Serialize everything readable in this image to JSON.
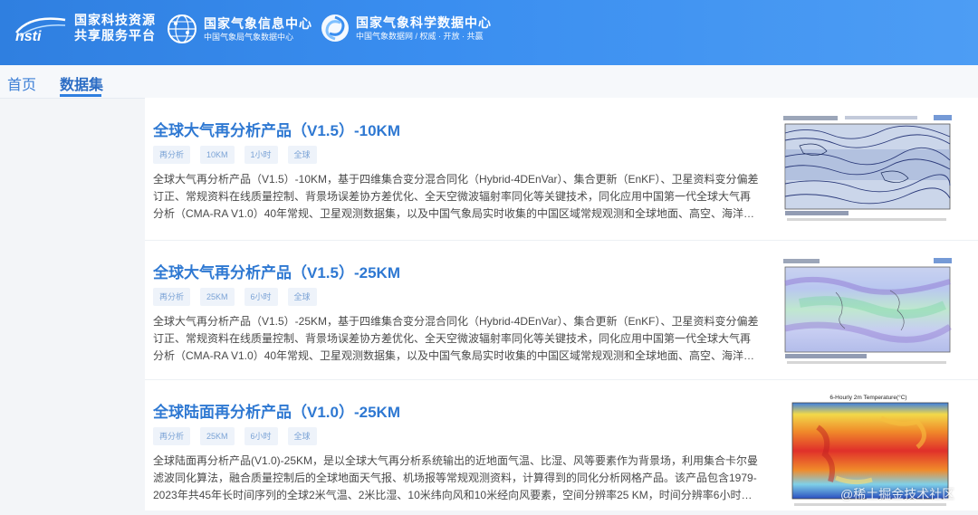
{
  "header": {
    "brands": [
      {
        "line1": "国家科技资源",
        "line2": "共享服务平台",
        "logo_icon": "nsti-logo-icon"
      },
      {
        "line1": "国家气象信息中心",
        "line2": "中国气象局气象数据中心",
        "logo_icon": "globe-network-icon"
      },
      {
        "line1": "国家气象科学数据中心",
        "line2": "中国气象数据网 / 权威 · 开放 · 共赢",
        "logo_icon": "swirl-logo-icon"
      }
    ],
    "bg_color": "#3a8ef0"
  },
  "nav": {
    "items": [
      {
        "label": "首页"
      },
      {
        "label": "数据集"
      }
    ],
    "active_index": 1
  },
  "datasets": [
    {
      "title": "全球大气再分析产品（V1.5）-10KM",
      "tags": [
        "再分析",
        "10KM",
        "1小时",
        "全球"
      ],
      "description_lines": [
        "全球大气再分析产品（V1.5）-10KM，基于四维集合变分混合同化（Hybrid-4DEnVar）、集合更新（EnKF）、卫星资料变分偏差",
        "订正、常规资料在线质量控制、背景场误差协方差优化、全天空微波辐射率同化等关键技术，同化应用中国第一代全球大气再",
        "分析（CMA-RA V1.0）40年常规、卫星观测数据集，以及中国气象局实时收集的中国区域常规观测和全球地面、高空、海洋…"
      ],
      "thumbnail": "isobar-map-thumbnail"
    },
    {
      "title": "全球大气再分析产品（V1.5）-25KM",
      "tags": [
        "再分析",
        "25KM",
        "6小时",
        "全球"
      ],
      "description_lines": [
        "全球大气再分析产品（V1.5）-25KM，基于四维集合变分混合同化（Hybrid-4DEnVar）、集合更新（EnKF）、卫星资料变分偏差",
        "订正、常规资料在线质量控制、背景场误差协方差优化、全天空微波辐射率同化等关键技术，同化应用中国第一代全球大气再",
        "分析（CMA-RA V1.0）40年常规、卫星观测数据集，以及中国气象局实时收集的中国区域常规观测和全球地面、高空、海洋…"
      ],
      "thumbnail": "humidity-map-thumbnail"
    },
    {
      "title": "全球陆面再分析产品（V1.0）-25KM",
      "tags": [
        "再分析",
        "25KM",
        "6小时",
        "全球"
      ],
      "description_lines": [
        "全球陆面再分析产品(V1.0)-25KM，是以全球大气再分析系统输出的近地面气温、比湿、风等要素作为背景场，利用集合卡尔曼",
        "滤波同化算法，融合质量控制后的全球地面天气报、机场报等常规观测资料，计算得到的同化分析网格产品。该产品包含1979-",
        "2023年共45年长时间序列的全球2米气温、2米比湿、10米纬向风和10米经向风要素，空间分辨率25 KM，时间分辨率6小时…"
      ],
      "thumbnail": "temperature-map-thumbnail",
      "thumbnail_title": "6-Hourly 2m Temperature(°C)"
    }
  ],
  "watermark": "@稀土掘金技术社区"
}
